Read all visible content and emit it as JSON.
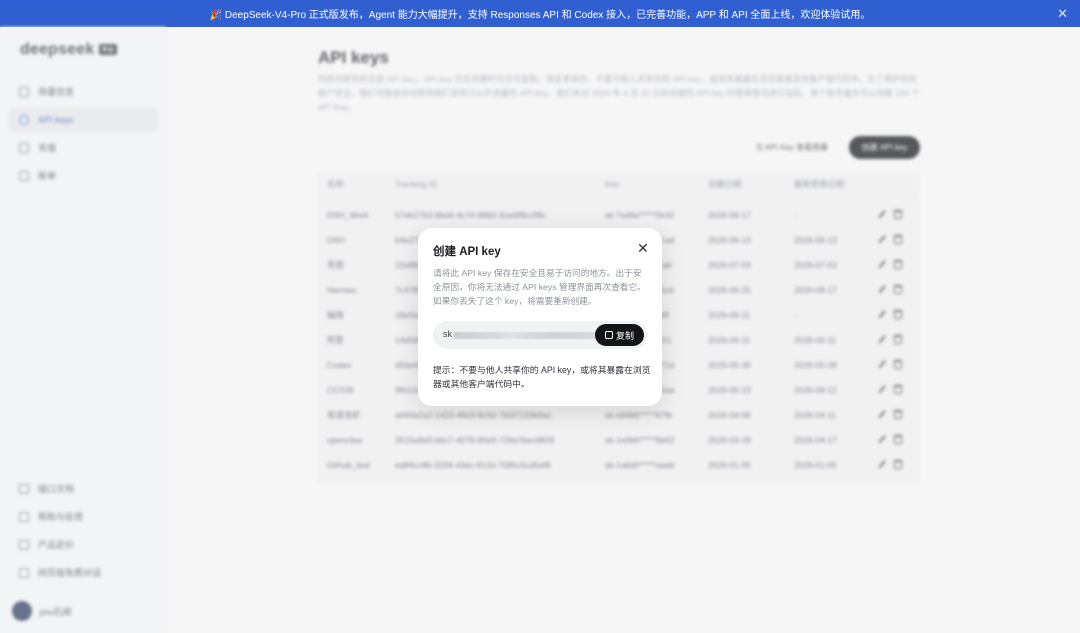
{
  "banner": {
    "text": "🎉 DeepSeek-V4-Pro 正式版发布，Agent 能力大幅提升，支持 Responses API 和 Codex 接入，已完善功能，APP 和 API 全面上线，欢迎体验试用。",
    "close": "✕"
  },
  "sidebar": {
    "logo": "deepseek",
    "logo_tag": "平台",
    "items": [
      {
        "label": "用量信息"
      },
      {
        "label": "API keys"
      },
      {
        "label": "充值"
      },
      {
        "label": "账单"
      }
    ],
    "bottom_items": [
      {
        "label": "接口文档"
      },
      {
        "label": "帮助与反馈"
      },
      {
        "label": "产品定价"
      },
      {
        "label": "网页版免费对话"
      }
    ],
    "user": "you石闻"
  },
  "main": {
    "title": "API keys",
    "description": "列表内是你的全部 API key，API key 仅在创建时可见可复制，请妥善保存。不要与他人共享你的 API key，或将其暴露在浏览器或其他客户端代码中。为了保护你的帐户安全，我们可能会自动禁用我们发现已公开泄露的 API key。我们未对 2024 年 4 月 25 日前创建的 API key 的使用情况进行追踪。单个账号最多可以创建 100 个 API Key。",
    "btn_usage": "☰ API Key 查看用量",
    "btn_create": "创建 API key",
    "table": {
      "headers": [
        "名称",
        "Tracking ID",
        "Key",
        "创建日期",
        "最新使用日期"
      ],
      "rows": [
        [
          "DSH_Work",
          "57de27b3-8bd4-4c74-8883-3ce6ff8c2f8c",
          "sk-7a46e*****5b32",
          "2026-06-17",
          "-"
        ],
        [
          "DSH",
          "b4e27c13-dd93-4a31-b0d5-1e8c7fd8a217",
          "sk-0d47e*****e1ad",
          "2026-06-13",
          "2026-06-13"
        ],
        [
          "灵感",
          "22e88a7b-51d0-4b2c-9f31-43b8a1c70e93",
          "sk-5bf0c*****b1a6",
          "2026-07-03",
          "2026-07-03"
        ],
        [
          "Hermes",
          "7c47f8e2-1a3b-4c6d-8e9f-0a1b2c3d4e5f",
          "sk-e20d1*****b5cb",
          "2026-06-25",
          "2026-08-17"
        ],
        [
          "编排",
          "18e5b2c4-7d81-4f9a-a3b6-c5d7e9f1a2b4",
          "sk-7b3c4*****b4ff",
          "2026-06-11",
          "-"
        ],
        [
          "阿里",
          "14d58e3f-2a6b-4c8d-9e1f-3a5b7c9d1e2f",
          "sk-f2a8c*****d321",
          "2026-06-11",
          "2026-06-11"
        ],
        [
          "Codex",
          "d5be4a2c-8f13-4e7b-b2d9-6c1a3e5f7b9d",
          "sk-9c1d7*****371d",
          "2026-05-26",
          "2026-05-28"
        ],
        [
          "CC/OB",
          "9fb12e7a-4c3d-4b8e-a1f5-2d7c9e3b5a1f",
          "sk-3e8b5*****75aa",
          "2026-05-23",
          "2026-08-12"
        ],
        [
          "有道龙虾",
          "a690b2a2-1423-46d3-8c6d-7b5f7233b9ac",
          "sk-a9466*****67fb",
          "2026-04-06",
          "2026-04-11"
        ],
        [
          "openclaw",
          "3515a8d3-bbc7-4079-90e9-729a7bec9829",
          "sk-1e0b6*****8d42",
          "2026-03-29",
          "2026-04-17"
        ],
        [
          "Github_test",
          "ed84cc86-3194-43dc-912d-7085c5cd5ef8",
          "sk-1a6d0*****aaeb",
          "2026-01-05",
          "2026-01-05"
        ]
      ]
    }
  },
  "modal": {
    "title": "创建 API key",
    "close": "✕",
    "body": "请将此 API key 保存在安全且易于访问的地方。出于安全原因，你将无法通过 API keys 管理界面再次查看它。如果你丢失了这个 key，将需要重新创建。",
    "key_prefix": "sk",
    "copy_label": "复制",
    "tip": "提示：不要与他人共享你的 API key，或将其暴露在浏览器或其他客户端代码中。"
  }
}
